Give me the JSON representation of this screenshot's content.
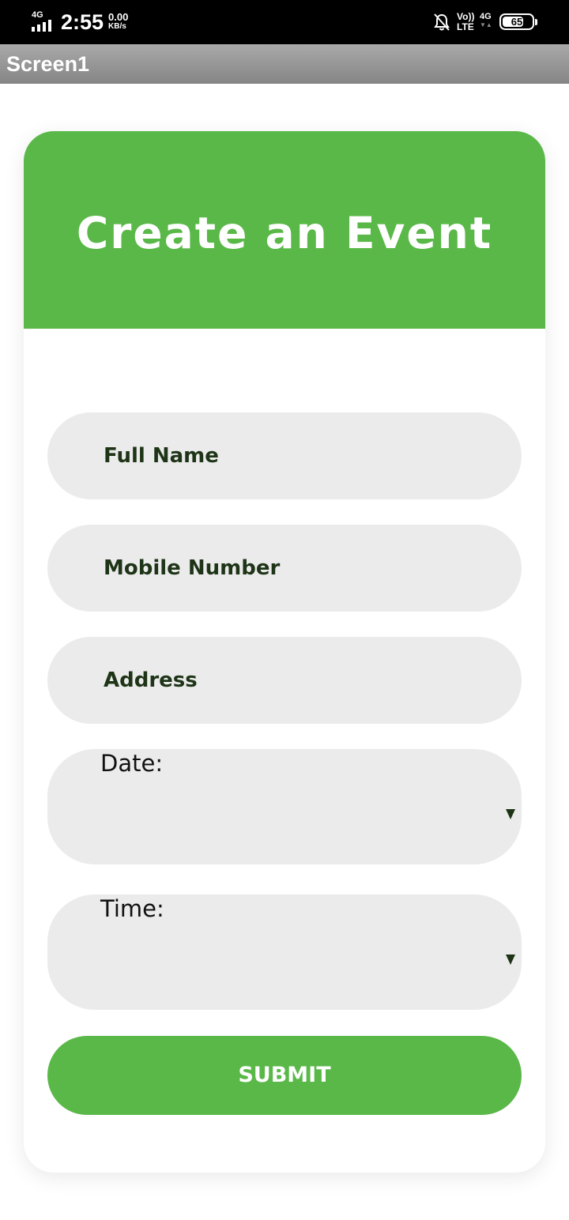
{
  "status_bar": {
    "network_type": "4G",
    "time": "2:55",
    "speed_value": "0.00",
    "speed_unit": "KB/s",
    "volte_label": "Vo))",
    "lte_label": "LTE",
    "network_type_right": "4G",
    "battery_level": "65",
    "icons": [
      "signal-bars-icon",
      "mute-bell-icon",
      "battery-icon"
    ]
  },
  "app_bar": {
    "title": "Screen1"
  },
  "form": {
    "heading": "Create an Event",
    "full_name_placeholder": "Full Name",
    "mobile_placeholder": "Mobile Number",
    "address_placeholder": "Address",
    "date_label": "Date:",
    "time_label": "Time:",
    "submit_label": "SUBMIT"
  },
  "colors": {
    "accent": "#5ab848",
    "field_background": "#ebebeb",
    "field_text": "#1e3417",
    "status_bar": "#000000"
  }
}
